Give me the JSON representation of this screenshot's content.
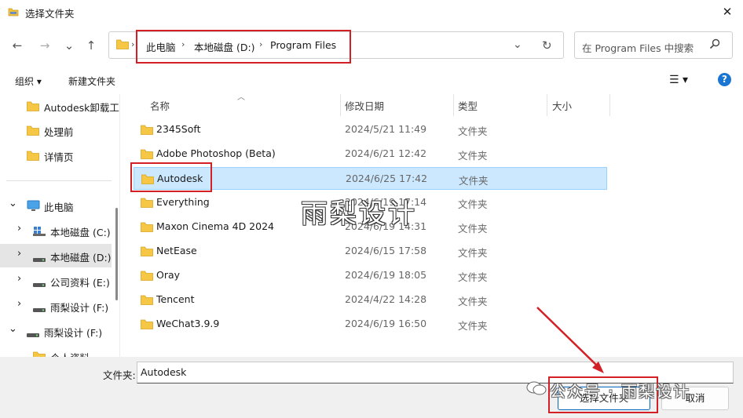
{
  "window": {
    "title": "选择文件夹",
    "close_glyph": "✕"
  },
  "nav": {
    "back": "←",
    "forward": "→",
    "recent": "⌄",
    "up": "↑",
    "dropdown": "⌄",
    "refresh": "↻"
  },
  "address": {
    "crumbs": [
      "此电脑",
      "本地磁盘 (D:)",
      "Program Files"
    ],
    "separator": "›"
  },
  "search": {
    "placeholder": "在 Program Files 中搜索"
  },
  "toolbar": {
    "organize": "组织 ▾",
    "new_folder": "新建文件夹",
    "view": "☰ ▾",
    "help": "?"
  },
  "nav_pane": {
    "items": [
      {
        "label": "Autodesk卸载工",
        "icon": "folder-icon"
      },
      {
        "label": "处理前",
        "icon": "folder-icon"
      },
      {
        "label": "详情页",
        "icon": "folder-icon"
      },
      {
        "label": "此电脑",
        "icon": "computer-icon",
        "expander": "⌄"
      },
      {
        "label": "本地磁盘 (C:)",
        "icon": "windows-drive-icon",
        "expander": "›"
      },
      {
        "label": "本地磁盘 (D:)",
        "icon": "drive-icon",
        "expander": "›"
      },
      {
        "label": "公司资料 (E:)",
        "icon": "drive-icon",
        "expander": "›"
      },
      {
        "label": "雨梨设计 (F:)",
        "icon": "drive-icon",
        "expander": "›"
      },
      {
        "label": "雨梨设计 (F:)",
        "icon": "drive-icon",
        "expander": "⌄"
      },
      {
        "label": "个人资料",
        "icon": "folder-icon"
      }
    ]
  },
  "columns": {
    "name": "名称",
    "date": "修改日期",
    "type": "类型",
    "size": "大小"
  },
  "files": [
    {
      "name": "2345Soft",
      "date": "2024/5/21 11:49",
      "type": "文件夹"
    },
    {
      "name": "Adobe Photoshop (Beta)",
      "date": "2024/6/21 12:42",
      "type": "文件夹"
    },
    {
      "name": "Autodesk",
      "date": "2024/6/25 17:42",
      "type": "文件夹"
    },
    {
      "name": "Everything",
      "date": "2024/6/19 17:14",
      "type": "文件夹"
    },
    {
      "name": "Maxon Cinema 4D 2024",
      "date": "2024/6/19 14:31",
      "type": "文件夹"
    },
    {
      "name": "NetEase",
      "date": "2024/6/15 17:58",
      "type": "文件夹"
    },
    {
      "name": "Oray",
      "date": "2024/6/19 18:05",
      "type": "文件夹"
    },
    {
      "name": "Tencent",
      "date": "2024/4/22 14:28",
      "type": "文件夹"
    },
    {
      "name": "WeChat3.9.9",
      "date": "2024/6/19 16:50",
      "type": "文件夹"
    }
  ],
  "bottom": {
    "folder_label": "文件夹:",
    "folder_value": "Autodesk",
    "select_button": "选择文件夹",
    "cancel_button": "取消"
  },
  "watermark": {
    "center": "雨梨设计",
    "bottom": "公众号 · 雨梨设计"
  },
  "colors": {
    "annotation_red": "#d32027",
    "selection": "#cce8ff",
    "accent": "#0067c0"
  }
}
